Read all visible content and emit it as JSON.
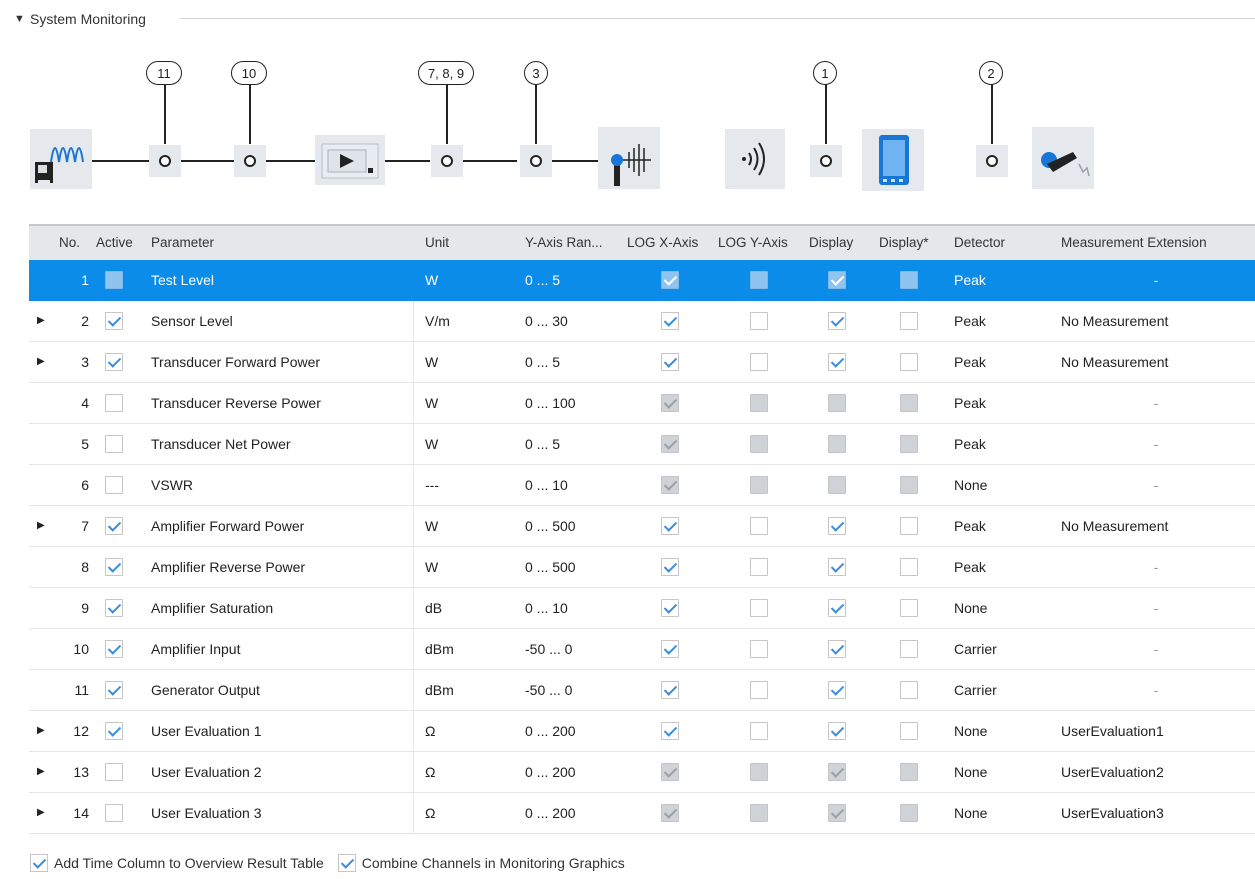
{
  "section": {
    "toggle_icon": "triangle-down",
    "title": "System Monitoring"
  },
  "diagram": {
    "badges": [
      "11",
      "10",
      "7, 8, 9",
      "3",
      "1",
      "2"
    ],
    "devices": [
      "signal-generator-icon",
      "amplifier-icon",
      "antenna-icon",
      "field-probe-icon",
      "tablet-icon",
      "eut-probe-icon"
    ]
  },
  "table": {
    "columns": [
      "No.",
      "Active",
      "Parameter",
      "Unit",
      "Y-Axis Ran...",
      "LOG X-Axis",
      "LOG Y-Axis",
      "Display",
      "Display*",
      "Detector",
      "Measurement Extension"
    ],
    "rows": [
      {
        "no": "1",
        "expand": "",
        "active": false,
        "param": "Test Level",
        "unit": "W",
        "range": "0 ... 5",
        "logx": true,
        "logy": false,
        "disp": true,
        "disp2": false,
        "detector": "Peak",
        "ext": "-",
        "selected": true
      },
      {
        "no": "2",
        "expand": "▶",
        "active": true,
        "param": "Sensor Level",
        "unit": "V/m",
        "range": "0 ... 30",
        "logx": true,
        "logy": false,
        "disp": true,
        "disp2": false,
        "detector": "Peak",
        "ext": "No Measurement"
      },
      {
        "no": "3",
        "expand": "▶",
        "active": true,
        "param": "Transducer Forward Power",
        "unit": "W",
        "range": "0 ... 5",
        "logx": true,
        "logy": false,
        "disp": true,
        "disp2": false,
        "detector": "Peak",
        "ext": "No Measurement"
      },
      {
        "no": "4",
        "expand": "",
        "active": false,
        "param": "Transducer Reverse Power",
        "unit": "W",
        "range": "0 ... 100",
        "logx": true,
        "logy": false,
        "disp": false,
        "disp2": false,
        "detector": "Peak",
        "ext": "-"
      },
      {
        "no": "5",
        "expand": "",
        "active": false,
        "param": "Transducer Net Power",
        "unit": "W",
        "range": "0 ... 5",
        "logx": true,
        "logy": false,
        "disp": false,
        "disp2": false,
        "detector": "Peak",
        "ext": "-"
      },
      {
        "no": "6",
        "expand": "",
        "active": false,
        "param": "VSWR",
        "unit": "---",
        "range": "0 ... 10",
        "logx": true,
        "logy": false,
        "disp": false,
        "disp2": false,
        "detector": "None",
        "ext": "-"
      },
      {
        "no": "7",
        "expand": "▶",
        "active": true,
        "param": "Amplifier Forward Power",
        "unit": "W",
        "range": "0 ... 500",
        "logx": true,
        "logy": false,
        "disp": true,
        "disp2": false,
        "detector": "Peak",
        "ext": "No Measurement"
      },
      {
        "no": "8",
        "expand": "",
        "active": true,
        "param": "Amplifier Reverse Power",
        "unit": "W",
        "range": "0 ... 500",
        "logx": true,
        "logy": false,
        "disp": true,
        "disp2": false,
        "detector": "Peak",
        "ext": "-"
      },
      {
        "no": "9",
        "expand": "",
        "active": true,
        "param": "Amplifier Saturation",
        "unit": "dB",
        "range": "0 ... 10",
        "logx": true,
        "logy": false,
        "disp": true,
        "disp2": false,
        "detector": "None",
        "ext": "-"
      },
      {
        "no": "10",
        "expand": "",
        "active": true,
        "param": "Amplifier Input",
        "unit": "dBm",
        "range": "-50 ... 0",
        "logx": true,
        "logy": false,
        "disp": true,
        "disp2": false,
        "detector": "Carrier",
        "ext": "-"
      },
      {
        "no": "11",
        "expand": "",
        "active": true,
        "param": "Generator Output",
        "unit": "dBm",
        "range": "-50 ... 0",
        "logx": true,
        "logy": false,
        "disp": true,
        "disp2": false,
        "detector": "Carrier",
        "ext": "-"
      },
      {
        "no": "12",
        "expand": "▶",
        "active": true,
        "param": "User Evaluation 1",
        "unit": "Ω",
        "range": "0 ... 200",
        "logx": true,
        "logy": false,
        "disp": true,
        "disp2": false,
        "detector": "None",
        "ext": "UserEvaluation1"
      },
      {
        "no": "13",
        "expand": "▶",
        "active": false,
        "param": "User Evaluation 2",
        "unit": "Ω",
        "range": "0 ... 200",
        "logx": true,
        "logy": false,
        "disp": true,
        "disp2": false,
        "detector": "None",
        "ext": "UserEvaluation2"
      },
      {
        "no": "14",
        "expand": "▶",
        "active": false,
        "param": "User Evaluation 3",
        "unit": "Ω",
        "range": "0 ... 200",
        "logx": true,
        "logy": false,
        "disp": true,
        "disp2": false,
        "detector": "None",
        "ext": "UserEvaluation3"
      }
    ]
  },
  "footer": {
    "add_time_label": "Add Time Column to Overview Result Table",
    "add_time_checked": true,
    "combine_label": "Combine Channels in Monitoring Graphics",
    "combine_checked": true
  },
  "colors": {
    "selection": "#0c8ce9",
    "check": "#3a8de0",
    "header_bg": "#e5e7ea"
  }
}
